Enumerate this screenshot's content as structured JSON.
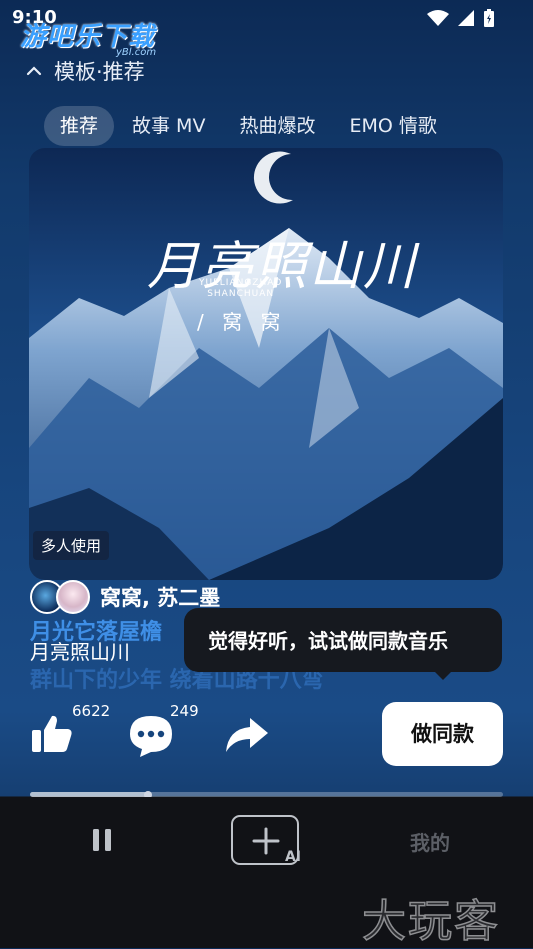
{
  "status_bar": {
    "time": "9:10"
  },
  "watermark_top": {
    "text": "游吧乐下载",
    "sub": "yBl.com"
  },
  "header": {
    "title": "模板·推荐"
  },
  "tabs": [
    {
      "label": "推荐",
      "active": true
    },
    {
      "label": "故事 MV",
      "active": false
    },
    {
      "label": "热曲爆改",
      "active": false
    },
    {
      "label": "EMO 情歌",
      "active": false
    }
  ],
  "cover": {
    "title": "月亮照山川",
    "pinyin_line1": "YUELIANGZHAO",
    "pinyin_line2": "SHANCHUAN",
    "artist": "/ 窝 窝",
    "badge": "多人使用"
  },
  "artists": {
    "names": "窝窝, 苏二墨"
  },
  "lyrics": {
    "current": "月光它落屋檐",
    "next": "群山下的少年 绕着山路十八弯"
  },
  "song": {
    "title": "月亮照山川"
  },
  "tooltip": {
    "text": "觉得好听，试试做同款音乐"
  },
  "actions": {
    "likes": "6622",
    "comments": "249"
  },
  "make_same_button": {
    "label": "做同款"
  },
  "playback": {
    "progress_fraction": 0.25
  },
  "bottom_nav": {
    "create_label": "AI",
    "mine_label": "我的"
  },
  "watermark_bottom": {
    "text": "大玩客"
  },
  "colors": {
    "accent_lyric": "#3f8fe6",
    "background": "#17457d",
    "nav_bg": "#111216"
  }
}
